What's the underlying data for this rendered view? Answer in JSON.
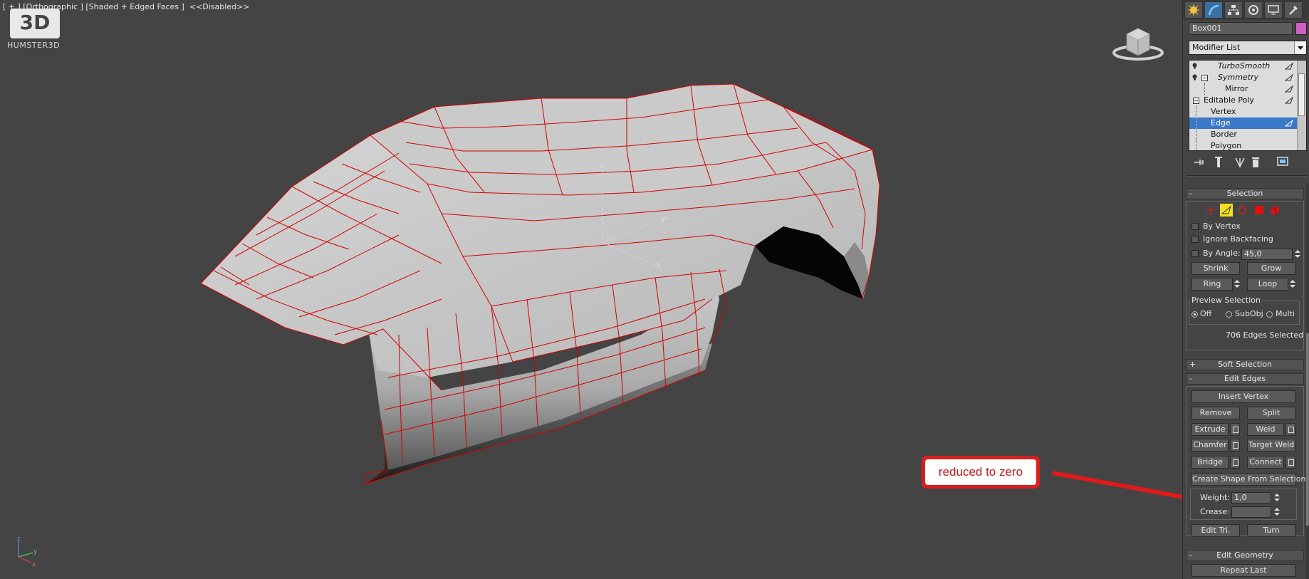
{
  "viewport": {
    "label": "[ + ] [Orthographic ] [Shaded + Edged Faces ]  <<Disabled>>",
    "logo_text": "3D",
    "logo_brand": "HUMSTER3D",
    "axis_labels": {
      "x": "x",
      "y": "y",
      "z": "z"
    },
    "callout_text": "reduced to zero"
  },
  "colors": {
    "viewport_bg": "#444444",
    "wire": "#d40000",
    "object_color": "#d060c8",
    "selection_highlight": "#3a78c8",
    "callout_red": "#d81f1f"
  },
  "panel": {
    "tabs": [
      {
        "icon": "create-icon"
      },
      {
        "icon": "modify-icon",
        "active": true
      },
      {
        "icon": "hierarchy-icon"
      },
      {
        "icon": "motion-icon"
      },
      {
        "icon": "display-icon"
      },
      {
        "icon": "utilities-icon"
      }
    ],
    "object_name": "Box001",
    "modifier_list": "Modifier List",
    "stack": [
      {
        "label": "TurboSmooth",
        "italic": true
      },
      {
        "label": "Symmetry",
        "italic": true
      },
      {
        "label": "Mirror"
      },
      {
        "label": "Editable Poly"
      },
      {
        "label": "Vertex"
      },
      {
        "label": "Edge",
        "selected": true
      },
      {
        "label": "Border"
      },
      {
        "label": "Polygon"
      }
    ],
    "selection": {
      "title": "Selection",
      "by_vertex": "By Vertex",
      "ignore_backfacing": "Ignore Backfacing",
      "by_angle": "By Angle:",
      "angle_value": "45,0",
      "shrink": "Shrink",
      "grow": "Grow",
      "ring": "Ring",
      "loop": "Loop",
      "preview_title": "Preview Selection",
      "preview_off": "Off",
      "preview_subobj": "SubObj",
      "preview_multi": "Multi",
      "status": "706 Edges Selected"
    },
    "soft_selection": {
      "title": "Soft Selection"
    },
    "edit_edges": {
      "title": "Edit Edges",
      "insert_vertex": "Insert Vertex",
      "remove": "Remove",
      "split": "Split",
      "extrude": "Extrude",
      "weld": "Weld",
      "chamfer": "Chamfer",
      "target_weld": "Target Weld",
      "bridge": "Bridge",
      "connect": "Connect",
      "create_shape": "Create Shape From Selection",
      "weight_label": "Weight:",
      "weight_value": "1,0",
      "crease_label": "Crease:",
      "crease_value": "",
      "edit_tri": "Edit Tri.",
      "turn": "Turn"
    },
    "edit_geometry": {
      "title": "Edit Geometry",
      "repeat_last": "Repeat Last"
    }
  }
}
